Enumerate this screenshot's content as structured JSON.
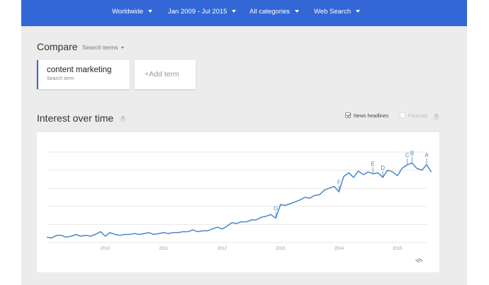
{
  "filters": [
    {
      "label": "Worldwide"
    },
    {
      "label": "Jan 2009 - Jul 2015"
    },
    {
      "label": "All categories"
    },
    {
      "label": "Web Search"
    }
  ],
  "compare": {
    "title": "Compare",
    "search_terms_label": "Search terms",
    "term": {
      "name": "content marketing",
      "type": "Search term"
    },
    "add_term": {
      "plus": "+",
      "label": "Add term"
    }
  },
  "interest": {
    "title": "Interest over time",
    "help": "?",
    "news_headlines": {
      "label": "News headlines",
      "checked": true
    },
    "forecast": {
      "label": "Forecast",
      "checked": false,
      "enabled": false
    },
    "embed_label": "</>"
  },
  "colors": {
    "accent": "#3367d6",
    "line": "#4a86c8",
    "grid": "#e8e8e8"
  },
  "chart_data": {
    "type": "line",
    "title": "",
    "xlabel": "",
    "ylabel": "",
    "x_ticks": [
      "2010",
      "2011",
      "2012",
      "2013",
      "2014",
      "2015"
    ],
    "x_range": [
      2009.0,
      2015.5
    ],
    "ylim": [
      0,
      100
    ],
    "grid": true,
    "series": [
      {
        "values": [
          [
            2009.0,
            6
          ],
          [
            2009.08,
            5
          ],
          [
            2009.17,
            8
          ],
          [
            2009.25,
            8
          ],
          [
            2009.33,
            6
          ],
          [
            2009.42,
            7
          ],
          [
            2009.5,
            9
          ],
          [
            2009.58,
            7
          ],
          [
            2009.67,
            8
          ],
          [
            2009.75,
            7
          ],
          [
            2009.83,
            9
          ],
          [
            2009.92,
            12
          ],
          [
            2010.0,
            7
          ],
          [
            2010.08,
            11
          ],
          [
            2010.17,
            9
          ],
          [
            2010.25,
            8
          ],
          [
            2010.33,
            9
          ],
          [
            2010.42,
            9
          ],
          [
            2010.5,
            10
          ],
          [
            2010.58,
            9
          ],
          [
            2010.67,
            10
          ],
          [
            2010.75,
            11
          ],
          [
            2010.83,
            9
          ],
          [
            2010.92,
            10
          ],
          [
            2011.0,
            11
          ],
          [
            2011.08,
            10
          ],
          [
            2011.17,
            11
          ],
          [
            2011.25,
            11
          ],
          [
            2011.33,
            12
          ],
          [
            2011.42,
            12
          ],
          [
            2011.5,
            14
          ],
          [
            2011.58,
            12
          ],
          [
            2011.67,
            13
          ],
          [
            2011.75,
            13
          ],
          [
            2011.83,
            15
          ],
          [
            2011.92,
            17
          ],
          [
            2012.0,
            15
          ],
          [
            2012.08,
            18
          ],
          [
            2012.17,
            22
          ],
          [
            2012.25,
            21
          ],
          [
            2012.33,
            23
          ],
          [
            2012.42,
            23
          ],
          [
            2012.5,
            25
          ],
          [
            2012.58,
            25
          ],
          [
            2012.67,
            28
          ],
          [
            2012.75,
            29
          ],
          [
            2012.83,
            31
          ],
          [
            2012.92,
            27
          ],
          [
            2013.0,
            42
          ],
          [
            2013.08,
            41
          ],
          [
            2013.17,
            43
          ],
          [
            2013.25,
            45
          ],
          [
            2013.33,
            47
          ],
          [
            2013.42,
            50
          ],
          [
            2013.5,
            49
          ],
          [
            2013.58,
            52
          ],
          [
            2013.67,
            53
          ],
          [
            2013.75,
            58
          ],
          [
            2013.83,
            60
          ],
          [
            2013.92,
            62
          ],
          [
            2014.0,
            56
          ],
          [
            2014.08,
            73
          ],
          [
            2014.17,
            77
          ],
          [
            2014.25,
            72
          ],
          [
            2014.33,
            79
          ],
          [
            2014.42,
            75
          ],
          [
            2014.5,
            78
          ],
          [
            2014.58,
            76
          ],
          [
            2014.67,
            77
          ],
          [
            2014.75,
            72
          ],
          [
            2014.83,
            80
          ],
          [
            2014.92,
            78
          ],
          [
            2015.0,
            74
          ],
          [
            2015.08,
            82
          ],
          [
            2015.17,
            86
          ],
          [
            2015.25,
            88
          ],
          [
            2015.33,
            82
          ],
          [
            2015.42,
            80
          ],
          [
            2015.5,
            86
          ],
          [
            2015.58,
            78
          ]
        ]
      }
    ],
    "annotations": [
      {
        "label": "G",
        "x": 2012.92
      },
      {
        "label": "F",
        "x": 2014.0
      },
      {
        "label": "E",
        "x": 2014.58
      },
      {
        "label": "D",
        "x": 2014.75
      },
      {
        "label": "C",
        "x": 2015.17
      },
      {
        "label": "B",
        "x": 2015.25
      },
      {
        "label": "A",
        "x": 2015.5
      }
    ]
  }
}
